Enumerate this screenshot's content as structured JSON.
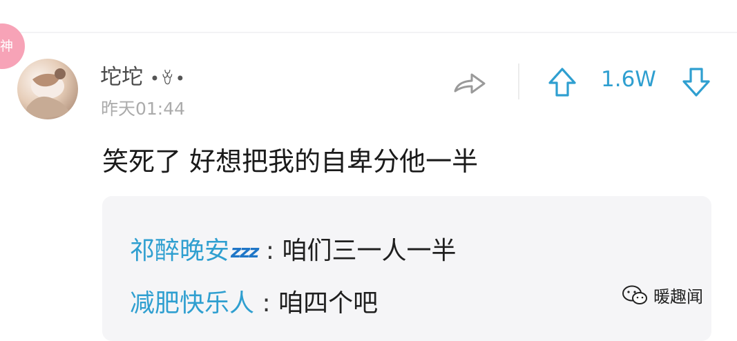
{
  "badge": {
    "label": "神",
    "color": "#f7a3b7"
  },
  "comment": {
    "username": "坨坨",
    "username_decoration": "•ꈊ•",
    "timestamp": "昨天01:44",
    "text": "笑死了 好想把我的自卑分他一半",
    "vote_count": "1.6W"
  },
  "replies": [
    {
      "author": "祁醉晚安",
      "author_emoji": "zzz",
      "separator": ":",
      "text": "咱们三一人一半"
    },
    {
      "author": "减肥快乐人",
      "separator": ":",
      "text": "咱四个吧"
    }
  ],
  "watermark": {
    "text": "暖趣闻",
    "icon": "wechat-icon"
  },
  "icons": [
    "share-icon",
    "upvote-arrow-icon",
    "downvote-arrow-icon"
  ],
  "colors": {
    "accent": "#2f9fd0",
    "badge": "#f7a3b7",
    "reply_bg": "#f5f5f7"
  }
}
